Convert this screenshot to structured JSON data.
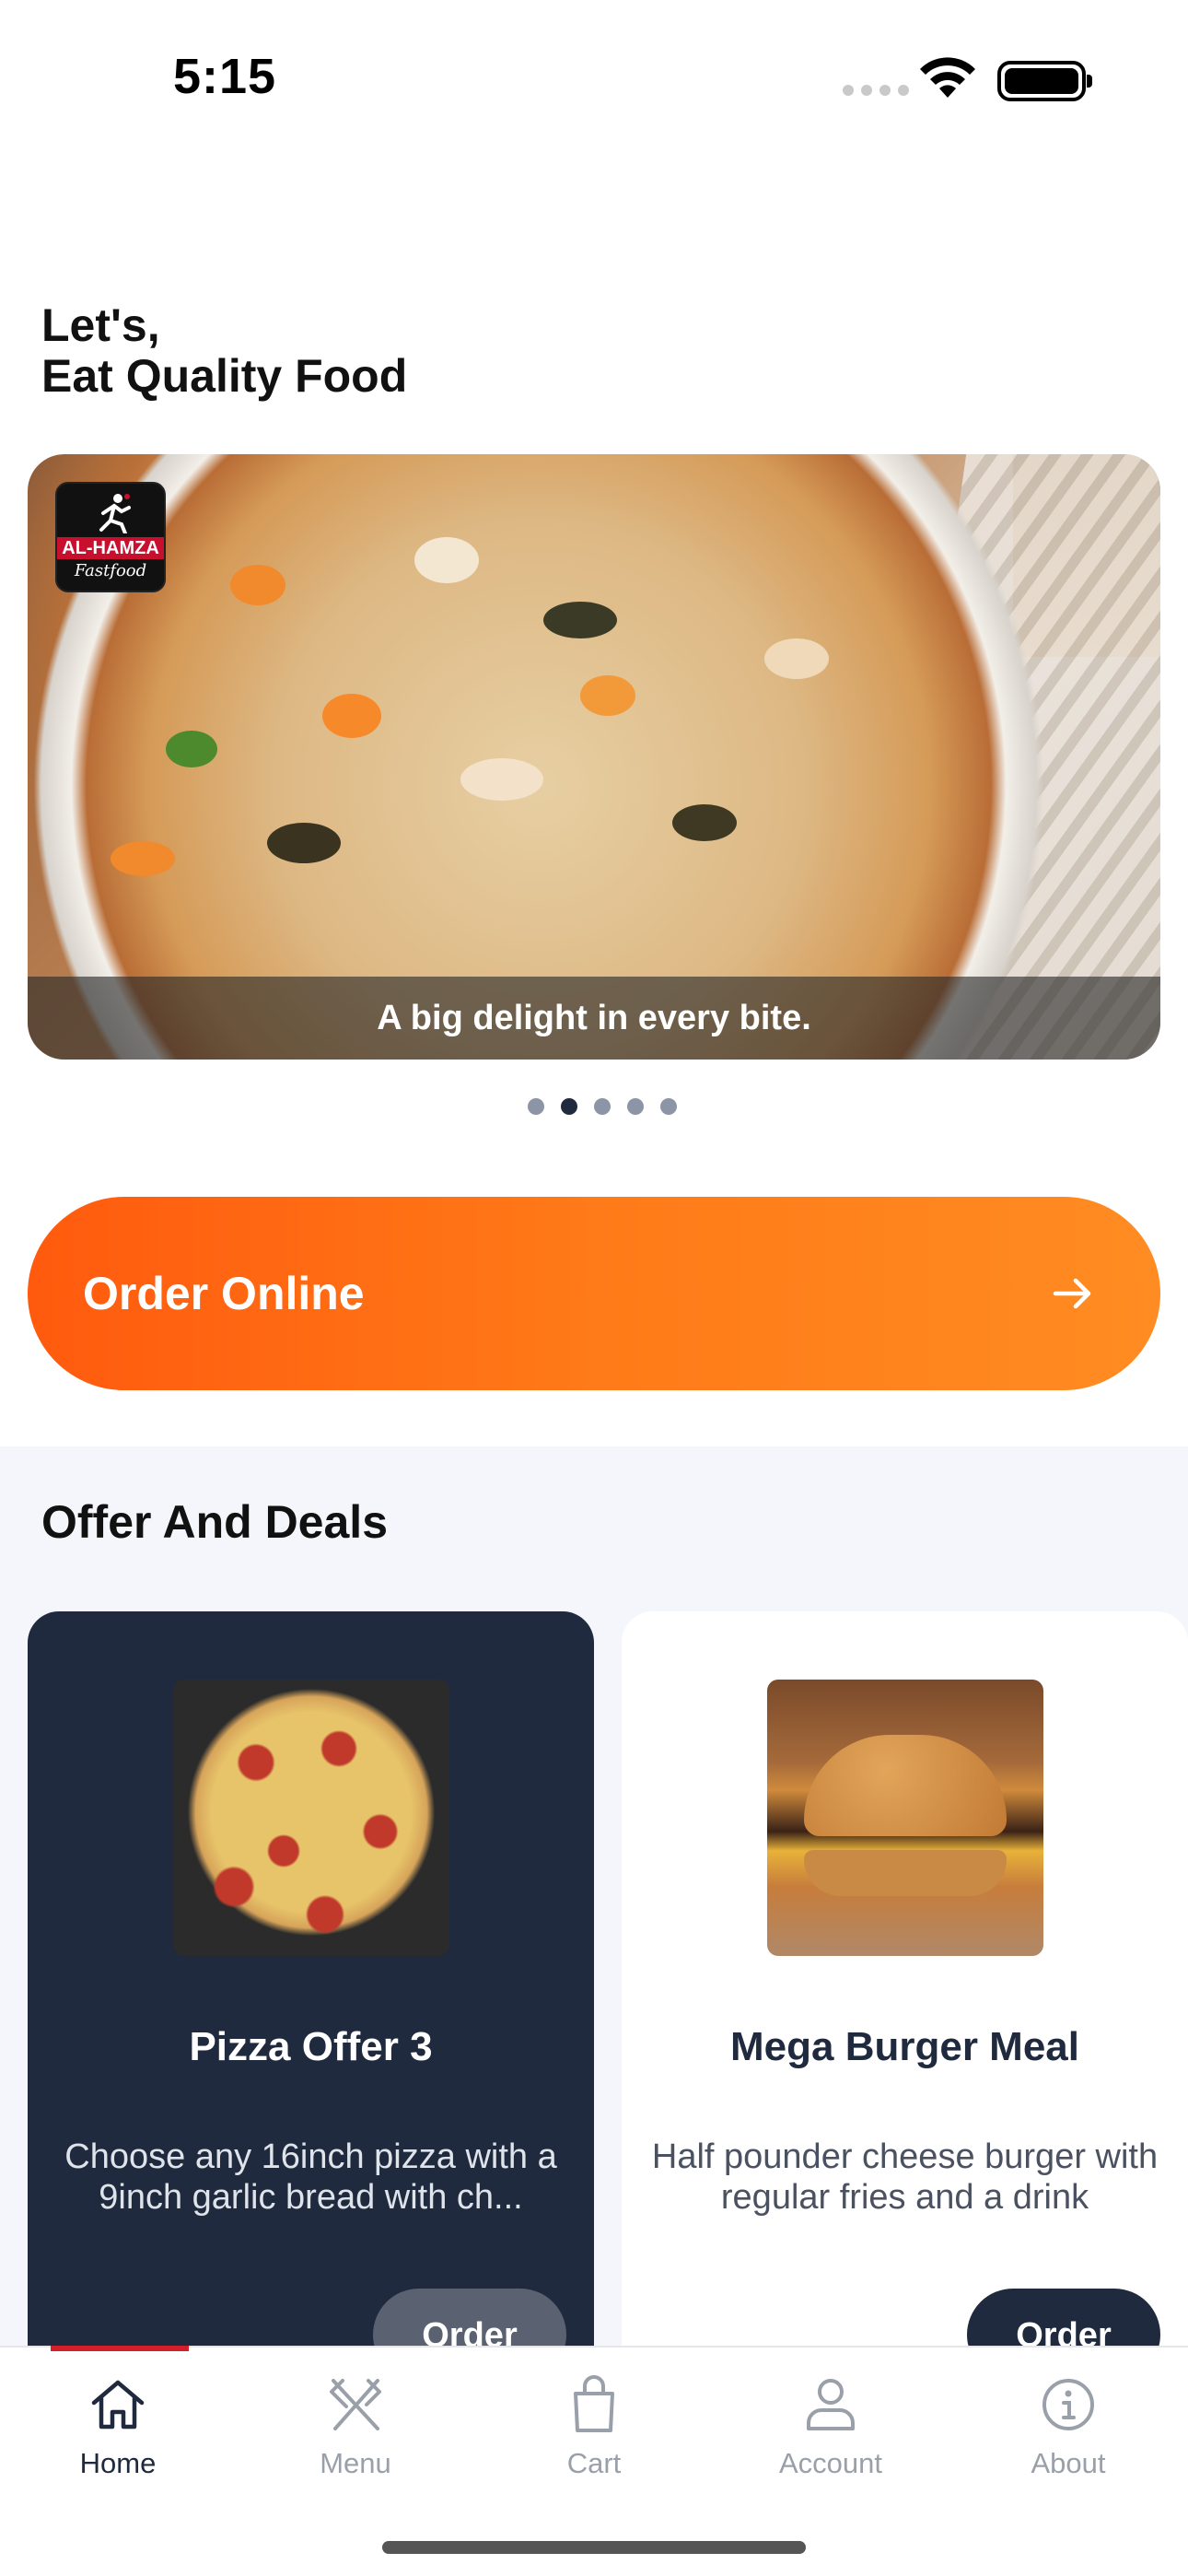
{
  "status_bar": {
    "time": "5:15"
  },
  "greeting": {
    "line1": "Let's,",
    "line2": "Eat Quality Food"
  },
  "hero": {
    "logo_brand": "AL-HAMZA",
    "logo_sub": "Fastfood",
    "caption": "A big delight in every bite.",
    "slide_count": 5,
    "active_slide": 2
  },
  "order_online": {
    "label": "Order Online"
  },
  "deals": {
    "title": "Offer And Deals",
    "items": [
      {
        "title": "Pizza Offer 3",
        "description": "Choose any 16inch pizza with a  9inch garlic bread with ch...",
        "button": "Order",
        "image": "pizza-image"
      },
      {
        "title": "Mega Burger Meal",
        "description": "Half pounder cheese burger with regular fries and a drink",
        "button": "Order",
        "image": "burger-image"
      }
    ]
  },
  "tabbar": {
    "items": [
      {
        "label": "Home",
        "icon": "home-icon",
        "active": true
      },
      {
        "label": "Menu",
        "icon": "fork-knife-icon",
        "active": false
      },
      {
        "label": "Cart",
        "icon": "shopping-bag-icon",
        "active": false
      },
      {
        "label": "Account",
        "icon": "user-icon",
        "active": false
      },
      {
        "label": "About",
        "icon": "info-icon",
        "active": false
      }
    ]
  },
  "colors": {
    "accent_orange": "#ff6a10",
    "navy": "#1f2a3e",
    "active_tab_indicator": "#d41f2b"
  }
}
